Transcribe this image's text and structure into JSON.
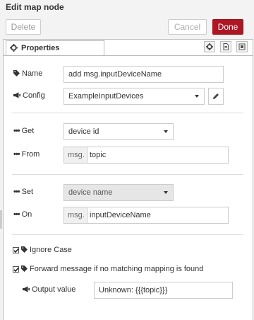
{
  "window": {
    "title": "Edit map node"
  },
  "toolbar": {
    "delete_label": "Delete",
    "cancel_label": "Cancel",
    "done_label": "Done"
  },
  "tabs": [
    {
      "label": "Properties"
    }
  ],
  "form": {
    "name": {
      "label": "Name",
      "value": "add msg.inputDeviceName",
      "icon": "tag-icon"
    },
    "config": {
      "label": "Config",
      "value": "ExampleInputDevices",
      "icon": "bullhorn-icon"
    },
    "get": {
      "label": "Get",
      "value": "device id",
      "icon": "ellipsis-icon"
    },
    "from": {
      "label": "From",
      "prefix": "msg.",
      "value": "topic",
      "icon": "ellipsis-icon"
    },
    "set": {
      "label": "Set",
      "value": "device name",
      "icon": "ellipsis-icon"
    },
    "on": {
      "label": "On",
      "prefix": "msg.",
      "value": "inputDeviceName",
      "icon": "ellipsis-icon"
    },
    "ignore_case": {
      "label": "Ignore Case",
      "checked": true,
      "icon": "tag-icon"
    },
    "forward": {
      "label": "Forward message if no matching mapping is found",
      "checked": true,
      "icon": "tag-icon"
    },
    "output": {
      "label": "Output value",
      "value": "Unknown: {{{topic}}}",
      "icon": "bullhorn-icon"
    }
  },
  "colors": {
    "done": "#ad1625",
    "border": "#cccccc",
    "panel_bg": "#ffffff",
    "chrome_bg": "#f3f3f3"
  }
}
